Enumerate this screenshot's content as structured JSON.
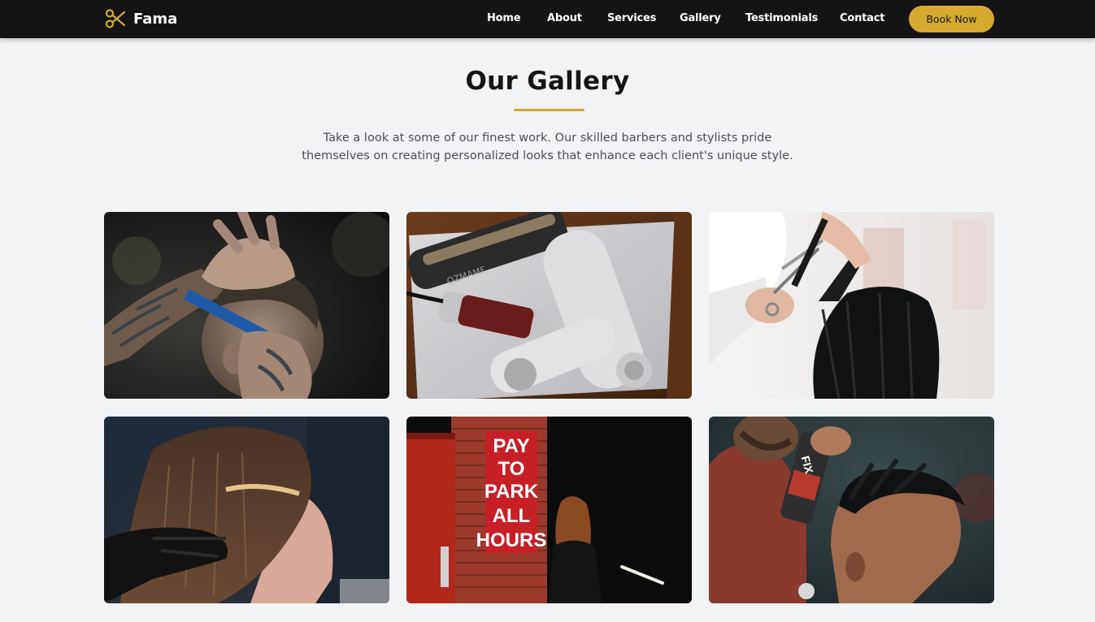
{
  "nav": {
    "brand_name": "Fama",
    "brand_icon": "scissors-icon",
    "links": [
      "Home",
      "About",
      "Services",
      "Gallery",
      "Testimonials",
      "Contact"
    ],
    "cta_label": "Book Now"
  },
  "gallery_section": {
    "title": "Our Gallery",
    "description": "Take a look at some of our finest work. Our skilled barbers and stylists pride themselves on creating personalized looks that enhance each client's unique style.",
    "images": [
      {
        "name": "gallery-image-barber-fade"
      },
      {
        "name": "gallery-image-clipper-tools"
      },
      {
        "name": "gallery-image-scissor-cut"
      },
      {
        "name": "gallery-image-hair-coloring"
      },
      {
        "name": "gallery-image-pay-to-park",
        "sign_lines": [
          "PAY",
          "TO",
          "PARK",
          "ALL",
          "HOURS"
        ]
      },
      {
        "name": "gallery-image-hairspray-styling",
        "can_label": "FIX"
      }
    ],
    "clipper_brand": "OZMAMF"
  },
  "colors": {
    "accent": "#d4aa2f",
    "navbar_bg": "#141414",
    "page_bg": "#f2f3f5",
    "title_text": "#151515",
    "body_text": "#4b4f56"
  }
}
